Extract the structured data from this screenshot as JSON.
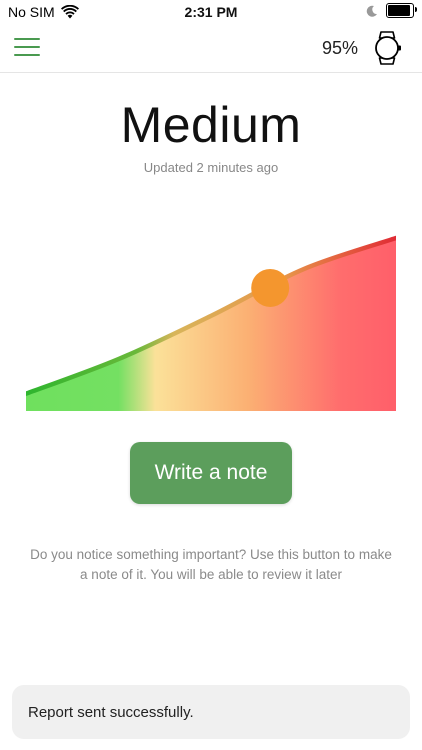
{
  "status_bar": {
    "carrier": "No SIM",
    "time": "2:31 PM",
    "battery_level": 0.9
  },
  "header": {
    "device_battery": "95%",
    "menu_icon": "hamburger-menu-icon",
    "device_icon": "smartwatch-icon",
    "accent_color": "#4a9a50"
  },
  "status": {
    "level": "Medium",
    "updated": "Updated 2 minutes ago"
  },
  "chart_data": {
    "type": "area",
    "x": [
      0,
      0.25,
      0.5,
      0.75,
      1.0
    ],
    "y": [
      0.1,
      0.3,
      0.55,
      0.82,
      1.0
    ],
    "marker_position": 0.66,
    "gradient": [
      {
        "stop": 0.0,
        "color": "#6fe05e"
      },
      {
        "stop": 0.25,
        "color": "#74e062"
      },
      {
        "stop": 0.35,
        "color": "#fbe199"
      },
      {
        "stop": 0.6,
        "color": "#fbb073"
      },
      {
        "stop": 0.85,
        "color": "#ff6d6d"
      },
      {
        "stop": 1.0,
        "color": "#ff5f6a"
      }
    ],
    "line_gradient": [
      {
        "stop": 0.0,
        "color": "#2eb52e"
      },
      {
        "stop": 0.3,
        "color": "#6ab83a"
      },
      {
        "stop": 0.4,
        "color": "#d8b55a"
      },
      {
        "stop": 0.7,
        "color": "#e7954a"
      },
      {
        "stop": 1.0,
        "color": "#e02b35"
      }
    ],
    "marker_color": "#f4962e"
  },
  "actions": {
    "note_label": "Write a note"
  },
  "help_text": "Do you notice something important? Use this button to make a note of it. You will be able to review it later",
  "toast": {
    "message": "Report sent successfully."
  }
}
